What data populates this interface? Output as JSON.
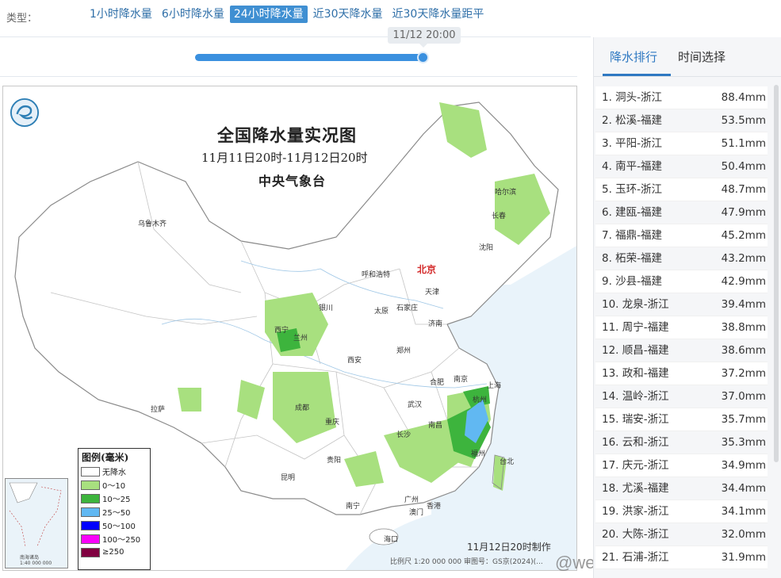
{
  "header": {
    "type_label": "类型：",
    "tabs": [
      {
        "label": "1小时降水量",
        "active": false
      },
      {
        "label": "6小时降水量",
        "active": false
      },
      {
        "label": "24小时降水量",
        "active": true
      },
      {
        "label": "近30天降水量",
        "active": false
      },
      {
        "label": "近30天降水量距平",
        "active": false
      }
    ]
  },
  "slider": {
    "time_label": "11/12 20:00",
    "position": 1.0
  },
  "map": {
    "title": "全国降水量实况图",
    "subtitle": "11月11日20时-11月12日20时",
    "org": "中央气象台",
    "produced": "11月12日20时制作",
    "scale": "比例尺 1:20 000 000    审图号：GS京(2024)(...",
    "cities": {
      "urumqi": "乌鲁木齐",
      "lhasa": "拉萨",
      "xining": "西宁",
      "lanzhou": "兰州",
      "yinchuan": "银川",
      "hohhot": "呼和浩特",
      "beijing": "北京",
      "tianjin": "天津",
      "shijiazhuang": "石家庄",
      "taiyuan": "太原",
      "jinan": "济南",
      "zhengzhou": "郑州",
      "xian": "西安",
      "chengdu": "成都",
      "chongqing": "重庆",
      "guiyang": "贵阳",
      "kunming": "昆明",
      "nanning": "南宁",
      "guangzhou": "广州",
      "hongkong": "香港",
      "macau": "澳门",
      "haikou": "海口",
      "changsha": "长沙",
      "wuhan": "武汉",
      "nanchang": "南昌",
      "hefei": "合肥",
      "nanjing": "南京",
      "shanghai": "上海",
      "hangzhou": "杭州",
      "fuzhou": "福州",
      "taibei": "台北",
      "harbin": "哈尔滨",
      "changchun": "长春",
      "shenyang": "沈阳"
    },
    "legend": {
      "title": "图例(毫米)",
      "items": [
        {
          "label": "无降水",
          "color": "#ffffff"
        },
        {
          "label": "0～10",
          "color": "#a8e07f"
        },
        {
          "label": "10～25",
          "color": "#3db43d"
        },
        {
          "label": "25～50",
          "color": "#61b8f2"
        },
        {
          "label": "50～100",
          "color": "#0000fe"
        },
        {
          "label": "100～250",
          "color": "#f900f9"
        },
        {
          "label": "≥250",
          "color": "#800040"
        }
      ]
    },
    "inset_label": "南海诸岛\n1:40 000 000"
  },
  "watermark": "@weatherman_信欣",
  "panel": {
    "tabs": [
      {
        "label": "降水排行",
        "active": true
      },
      {
        "label": "时间选择",
        "active": false
      }
    ],
    "ranking": [
      {
        "name": "1. 洞头-浙江",
        "value": "88.4mm"
      },
      {
        "name": "2. 松溪-福建",
        "value": "53.5mm"
      },
      {
        "name": "3. 平阳-浙江",
        "value": "51.1mm"
      },
      {
        "name": "4. 南平-福建",
        "value": "50.4mm"
      },
      {
        "name": "5. 玉环-浙江",
        "value": "48.7mm"
      },
      {
        "name": "6. 建瓯-福建",
        "value": "47.9mm"
      },
      {
        "name": "7. 福鼎-福建",
        "value": "45.2mm"
      },
      {
        "name": "8. 柘荣-福建",
        "value": "43.2mm"
      },
      {
        "name": "9. 沙县-福建",
        "value": "42.9mm"
      },
      {
        "name": "10. 龙泉-浙江",
        "value": "39.4mm"
      },
      {
        "name": "11. 周宁-福建",
        "value": "38.8mm"
      },
      {
        "name": "12. 顺昌-福建",
        "value": "38.6mm"
      },
      {
        "name": "13. 政和-福建",
        "value": "37.2mm"
      },
      {
        "name": "14. 温岭-浙江",
        "value": "37.0mm"
      },
      {
        "name": "15. 瑞安-浙江",
        "value": "35.7mm"
      },
      {
        "name": "16. 云和-浙江",
        "value": "35.3mm"
      },
      {
        "name": "17. 庆元-浙江",
        "value": "34.9mm"
      },
      {
        "name": "18. 尤溪-福建",
        "value": "34.4mm"
      },
      {
        "name": "19. 洪家-浙江",
        "value": "34.1mm"
      },
      {
        "name": "20. 大陈-浙江",
        "value": "32.0mm"
      },
      {
        "name": "21. 石浦-浙江",
        "value": "31.9mm"
      }
    ]
  }
}
